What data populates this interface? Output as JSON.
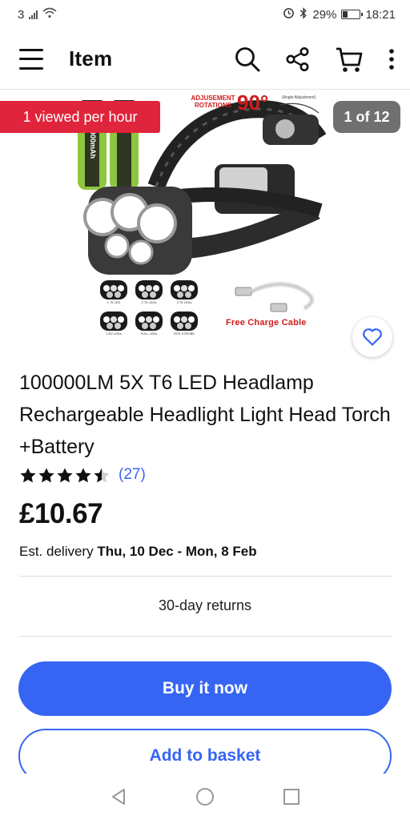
{
  "status_bar": {
    "network": "3",
    "battery": "29%",
    "battery_level": 0.29,
    "time": "18:21"
  },
  "header": {
    "title": "Item",
    "icons": [
      "menu-icon",
      "search-icon",
      "share-icon",
      "cart-icon",
      "more-icon"
    ]
  },
  "gallery": {
    "viewed_badge": "1 viewed per hour",
    "counter": "1 of 12",
    "image_text": {
      "adjustment": "ADJUSEMENT ROTATIONS",
      "angle": "90°",
      "angle_note": "(Angle Adjustment)",
      "battery_label": "9900mAh",
      "charge_cable": "Free  Charge Cable"
    },
    "modes": [
      "1 T6 LED",
      "2 T6 LEDs",
      "3 T6 LEDs",
      "2 R2 LEDs",
      "FULL LEDs",
      "SOS STROBE"
    ]
  },
  "product": {
    "title": "100000LM 5X T6 LED Headlamp Rechargeable Headlight Light Head Torch +Battery",
    "rating": 4.5,
    "rating_count": "(27)",
    "price": "£10.67",
    "delivery_label": "Est. delivery",
    "delivery_dates": "Thu, 10 Dec - Mon, 8 Feb",
    "returns": "30-day returns"
  },
  "actions": {
    "buy_now": "Buy it now",
    "add_to_basket": "Add to basket"
  },
  "colors": {
    "accent_blue": "#3665f3",
    "badge_red": "#e0243b",
    "counter_gray": "#707070",
    "image_red": "#d01c1c",
    "battery_green": "#8dc63f"
  }
}
